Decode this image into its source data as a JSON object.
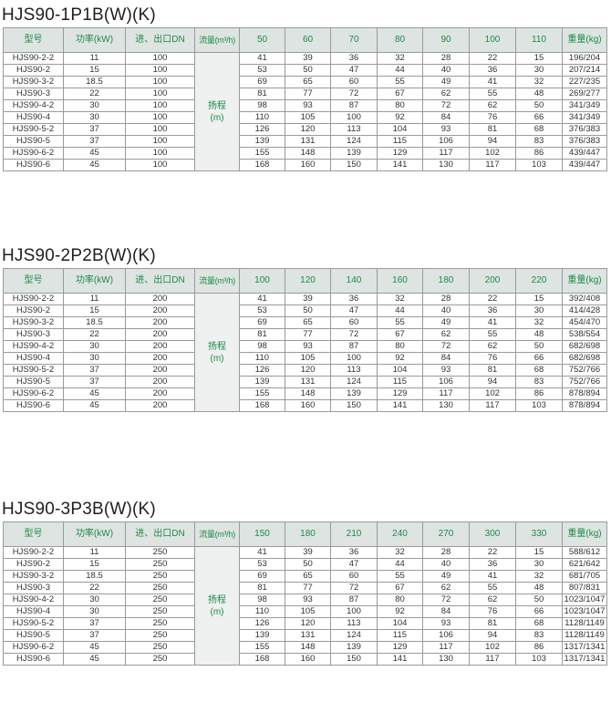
{
  "headers": {
    "model": "型号",
    "power": "功率(kW)",
    "port": "进、出口DN",
    "flow": "流量(m³/h)",
    "head": "扬程\n(m)",
    "weight": "重量(kg)"
  },
  "sections": [
    {
      "title": "HJS90-1P1B(W)(K)",
      "flows": [
        "50",
        "60",
        "70",
        "80",
        "90",
        "100",
        "110"
      ],
      "rows": [
        {
          "model": "HJS90-2-2",
          "power": "11",
          "dn": "100",
          "heads": [
            "41",
            "39",
            "36",
            "32",
            "28",
            "22",
            "15"
          ],
          "weight": "196/204"
        },
        {
          "model": "HJS90-2",
          "power": "15",
          "dn": "100",
          "heads": [
            "53",
            "50",
            "47",
            "44",
            "40",
            "36",
            "30"
          ],
          "weight": "207/214"
        },
        {
          "model": "HJS90-3-2",
          "power": "18.5",
          "dn": "100",
          "heads": [
            "69",
            "65",
            "60",
            "55",
            "49",
            "41",
            "32"
          ],
          "weight": "227/235"
        },
        {
          "model": "HJS90-3",
          "power": "22",
          "dn": "100",
          "heads": [
            "81",
            "77",
            "72",
            "67",
            "62",
            "55",
            "48"
          ],
          "weight": "269/277"
        },
        {
          "model": "HJS90-4-2",
          "power": "30",
          "dn": "100",
          "heads": [
            "98",
            "93",
            "87",
            "80",
            "72",
            "62",
            "50"
          ],
          "weight": "341/349"
        },
        {
          "model": "HJS90-4",
          "power": "30",
          "dn": "100",
          "heads": [
            "110",
            "105",
            "100",
            "92",
            "84",
            "76",
            "66"
          ],
          "weight": "341/349"
        },
        {
          "model": "HJS90-5-2",
          "power": "37",
          "dn": "100",
          "heads": [
            "126",
            "120",
            "113",
            "104",
            "93",
            "81",
            "68"
          ],
          "weight": "376/383"
        },
        {
          "model": "HJS90-5",
          "power": "37",
          "dn": "100",
          "heads": [
            "139",
            "131",
            "124",
            "115",
            "106",
            "94",
            "83"
          ],
          "weight": "376/383"
        },
        {
          "model": "HJS90-6-2",
          "power": "45",
          "dn": "100",
          "heads": [
            "155",
            "148",
            "139",
            "129",
            "117",
            "102",
            "86"
          ],
          "weight": "439/447"
        },
        {
          "model": "HJS90-6",
          "power": "45",
          "dn": "100",
          "heads": [
            "168",
            "160",
            "150",
            "141",
            "130",
            "117",
            "103"
          ],
          "weight": "439/447"
        }
      ]
    },
    {
      "title": "HJS90-2P2B(W)(K)",
      "flows": [
        "100",
        "120",
        "140",
        "160",
        "180",
        "200",
        "220"
      ],
      "rows": [
        {
          "model": "HJS90-2-2",
          "power": "11",
          "dn": "200",
          "heads": [
            "41",
            "39",
            "36",
            "32",
            "28",
            "22",
            "15"
          ],
          "weight": "392/408"
        },
        {
          "model": "HJS90-2",
          "power": "15",
          "dn": "200",
          "heads": [
            "53",
            "50",
            "47",
            "44",
            "40",
            "36",
            "30"
          ],
          "weight": "414/428"
        },
        {
          "model": "HJS90-3-2",
          "power": "18.5",
          "dn": "200",
          "heads": [
            "69",
            "65",
            "60",
            "55",
            "49",
            "41",
            "32"
          ],
          "weight": "454/470"
        },
        {
          "model": "HJS90-3",
          "power": "22",
          "dn": "200",
          "heads": [
            "81",
            "77",
            "72",
            "67",
            "62",
            "55",
            "48"
          ],
          "weight": "538/554"
        },
        {
          "model": "HJS90-4-2",
          "power": "30",
          "dn": "200",
          "heads": [
            "98",
            "93",
            "87",
            "80",
            "72",
            "62",
            "50"
          ],
          "weight": "682/698"
        },
        {
          "model": "HJS90-4",
          "power": "30",
          "dn": "200",
          "heads": [
            "110",
            "105",
            "100",
            "92",
            "84",
            "76",
            "66"
          ],
          "weight": "682/698"
        },
        {
          "model": "HJS90-5-2",
          "power": "37",
          "dn": "200",
          "heads": [
            "126",
            "120",
            "113",
            "104",
            "93",
            "81",
            "68"
          ],
          "weight": "752/766"
        },
        {
          "model": "HJS90-5",
          "power": "37",
          "dn": "200",
          "heads": [
            "139",
            "131",
            "124",
            "115",
            "106",
            "94",
            "83"
          ],
          "weight": "752/766"
        },
        {
          "model": "HJS90-6-2",
          "power": "45",
          "dn": "200",
          "heads": [
            "155",
            "148",
            "139",
            "129",
            "117",
            "102",
            "86"
          ],
          "weight": "878/894"
        },
        {
          "model": "HJS90-6",
          "power": "45",
          "dn": "200",
          "heads": [
            "168",
            "160",
            "150",
            "141",
            "130",
            "117",
            "103"
          ],
          "weight": "878/894"
        }
      ]
    },
    {
      "title": "HJS90-3P3B(W)(K)",
      "flows": [
        "150",
        "180",
        "210",
        "240",
        "270",
        "300",
        "330"
      ],
      "rows": [
        {
          "model": "HJS90-2-2",
          "power": "11",
          "dn": "250",
          "heads": [
            "41",
            "39",
            "36",
            "32",
            "28",
            "22",
            "15"
          ],
          "weight": "588/612"
        },
        {
          "model": "HJS90-2",
          "power": "15",
          "dn": "250",
          "heads": [
            "53",
            "50",
            "47",
            "44",
            "40",
            "36",
            "30"
          ],
          "weight": "621/642"
        },
        {
          "model": "HJS90-3-2",
          "power": "18.5",
          "dn": "250",
          "heads": [
            "69",
            "65",
            "60",
            "55",
            "49",
            "41",
            "32"
          ],
          "weight": "681/705"
        },
        {
          "model": "HJS90-3",
          "power": "22",
          "dn": "250",
          "heads": [
            "81",
            "77",
            "72",
            "67",
            "62",
            "55",
            "48"
          ],
          "weight": "807/831"
        },
        {
          "model": "HJS90-4-2",
          "power": "30",
          "dn": "250",
          "heads": [
            "98",
            "93",
            "87",
            "80",
            "72",
            "62",
            "50"
          ],
          "weight": "1023/1047"
        },
        {
          "model": "HJS90-4",
          "power": "30",
          "dn": "250",
          "heads": [
            "110",
            "105",
            "100",
            "92",
            "84",
            "76",
            "66"
          ],
          "weight": "1023/1047"
        },
        {
          "model": "HJS90-5-2",
          "power": "37",
          "dn": "250",
          "heads": [
            "126",
            "120",
            "113",
            "104",
            "93",
            "81",
            "68"
          ],
          "weight": "1128/1149"
        },
        {
          "model": "HJS90-5",
          "power": "37",
          "dn": "250",
          "heads": [
            "139",
            "131",
            "124",
            "115",
            "106",
            "94",
            "83"
          ],
          "weight": "1128/1149"
        },
        {
          "model": "HJS90-6-2",
          "power": "45",
          "dn": "250",
          "heads": [
            "155",
            "148",
            "139",
            "129",
            "117",
            "102",
            "86"
          ],
          "weight": "1317/1341"
        },
        {
          "model": "HJS90-6",
          "power": "45",
          "dn": "250",
          "heads": [
            "168",
            "160",
            "150",
            "141",
            "130",
            "117",
            "103"
          ],
          "weight": "1317/1341"
        }
      ]
    }
  ]
}
